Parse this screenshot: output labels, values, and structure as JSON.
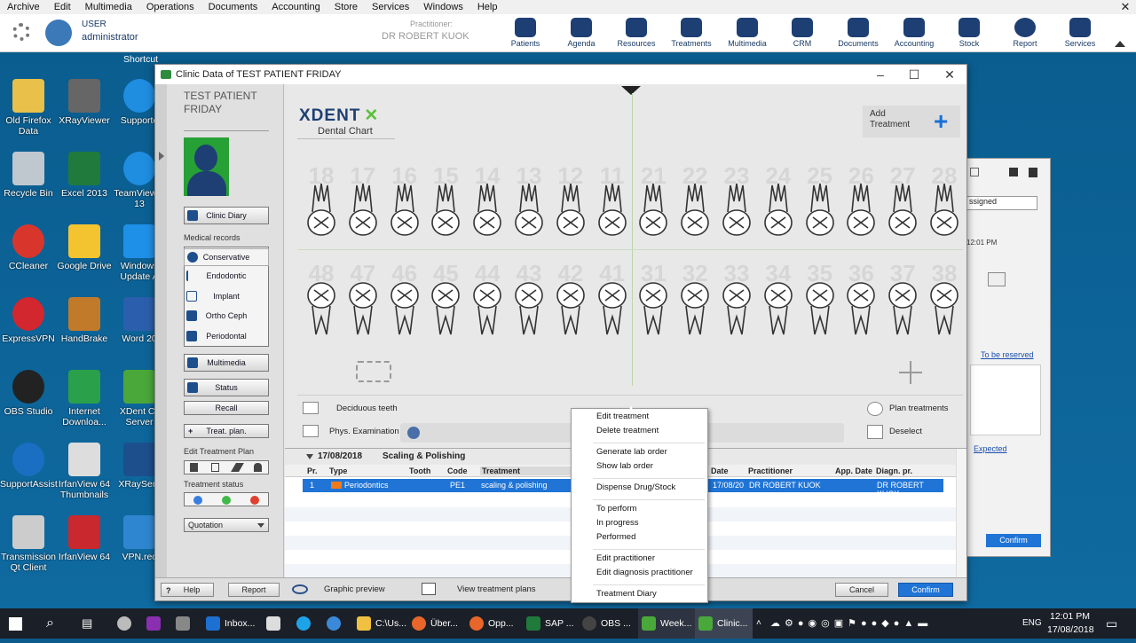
{
  "menubar": {
    "items": [
      "Archive",
      "Edit",
      "Multimedia",
      "Operations",
      "Documents",
      "Accounting",
      "Store",
      "Services",
      "Windows",
      "Help"
    ]
  },
  "user": {
    "label": "USER",
    "name": "administrator"
  },
  "practitioner": {
    "label": "Practitioner:",
    "name": "DR ROBERT KUOK"
  },
  "toolbar": {
    "items": [
      "Patients",
      "Agenda",
      "Resources",
      "Treatments",
      "Multimedia",
      "CRM",
      "Documents",
      "Accounting",
      "Stock",
      "Report",
      "Services"
    ]
  },
  "desktop": {
    "shortcut_label": "Shortcut",
    "icons": [
      [
        "Old Firefox Data",
        "XRayViewer",
        "Supporto"
      ],
      [
        "Recycle Bin",
        "Excel 2013",
        "TeamViewer 13"
      ],
      [
        "CCleaner",
        "Google Drive",
        "Windows Update A"
      ],
      [
        "ExpressVPN",
        "HandBrake",
        "Word 20"
      ],
      [
        "OBS Studio",
        "Internet Downloa...",
        "XDent Cli Server"
      ],
      [
        "SupportAssist",
        "IrfanView 64 Thumbnails",
        "XRayServ"
      ],
      [
        "Transmission Qt Client",
        "IrfanView 64",
        "VPN.rec"
      ]
    ]
  },
  "window": {
    "title": "Clinic Data of TEST PATIENT FRIDAY",
    "patient_name": "TEST PATIENT FRIDAY",
    "clinic_diary": "Clinic Diary",
    "medical_records": "Medical records",
    "records": [
      "Conservative",
      "Endodontic",
      "Implant",
      "Ortho Ceph",
      "Periodontal"
    ],
    "multimedia": "Multimedia",
    "status": "Status",
    "recall": "Recall",
    "treat_plan": "Treat. plan.",
    "edit_treatment_plan": "Edit Treatment Plan",
    "treatment_status": "Treatment status",
    "quotation": "Quotation",
    "logo": "XDENT",
    "logo_sub": "Dental Chart",
    "add_treatment": "Add Treatment",
    "upper_teeth": [
      "18",
      "17",
      "16",
      "15",
      "14",
      "13",
      "12",
      "11",
      "21",
      "22",
      "23",
      "24",
      "25",
      "26",
      "27",
      "28"
    ],
    "lower_teeth": [
      "48",
      "47",
      "46",
      "45",
      "44",
      "43",
      "42",
      "41",
      "31",
      "32",
      "33",
      "34",
      "35",
      "36",
      "37",
      "38"
    ],
    "deciduous": "Deciduous teeth",
    "phys_exam": "Phys. Examination",
    "plan_treatments": "Plan treatments",
    "deselect": "Deselect",
    "date_group": "17/08/2018",
    "date_group_title": "Scaling & Polishing",
    "columns": [
      "Pr.",
      "Type",
      "Tooth",
      "Code",
      "Treatment",
      "Date",
      "Practitioner",
      "App. Date",
      "Diagn. pr."
    ],
    "row": {
      "pr": "1",
      "type": "Periodontics",
      "tooth": "",
      "code": "PE1",
      "treatment": "scaling & polishing",
      "date": "17/08/20",
      "practitioner": "DR ROBERT KUOK",
      "app_date": "",
      "diagn": "DR ROBERT KUOK"
    },
    "help": "Help",
    "report": "Report",
    "graphic_preview": "Graphic preview",
    "view_plans": "View treatment plans",
    "cancel": "Cancel",
    "confirm": "Confirm"
  },
  "context_menu": [
    "Edit treatment",
    "Delete treatment",
    "Generate lab order",
    "Show lab order",
    "Dispense Drug/Stock",
    "To perform",
    "In progress",
    "Performed",
    "Edit practitioner",
    "Edit diagnosis practitioner",
    "Treatment Diary"
  ],
  "right_window": {
    "assigned": "ssigned",
    "time": "12:01 PM",
    "to_be_reserved": "To be reserved",
    "expected": "Expected",
    "confirm": "Confirm"
  },
  "taskbar": {
    "apps": [
      "Inbox...",
      "C:\\Us...",
      "Über...",
      "Opp...",
      "SAP ...",
      "OBS ...",
      "Week...",
      "Clinic..."
    ],
    "lang": "ENG",
    "time": "12:01 PM",
    "date": "17/08/2018"
  },
  "colors": {
    "accent": "#1a6fd6",
    "desktop": "#0d5a8c",
    "selected_row": "#1f74d6"
  }
}
